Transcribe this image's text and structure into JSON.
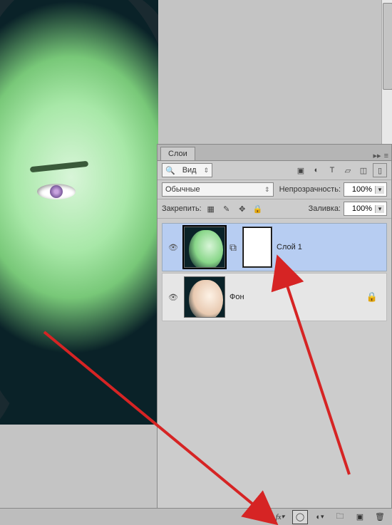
{
  "panel": {
    "tab": "Слои",
    "kind_label": "Вид",
    "blend_mode": "Обычные",
    "opacity_label": "Непрозрачность:",
    "opacity_value": "100%",
    "lock_label": "Закрепить:",
    "fill_label": "Заливка:",
    "fill_value": "100%"
  },
  "layers": {
    "items": [
      {
        "name": "Слой 1",
        "selected": true,
        "has_mask": true,
        "locked": false,
        "thumb": "green"
      },
      {
        "name": "Фон",
        "selected": false,
        "has_mask": false,
        "locked": true,
        "thumb": "skin"
      }
    ]
  },
  "filter_icons": [
    "image-filter-icon",
    "adjustment-filter-icon",
    "text-filter-icon",
    "shape-filter-icon",
    "smartobject-filter-icon"
  ],
  "lock_icons": [
    "lock-transparency-icon",
    "lock-pixels-icon",
    "lock-position-icon",
    "lock-all-icon"
  ],
  "bottombar": [
    "link-layers-icon",
    "fx-icon",
    "add-mask-icon",
    "adjustment-layer-icon",
    "group-icon",
    "new-layer-icon",
    "delete-icon"
  ]
}
